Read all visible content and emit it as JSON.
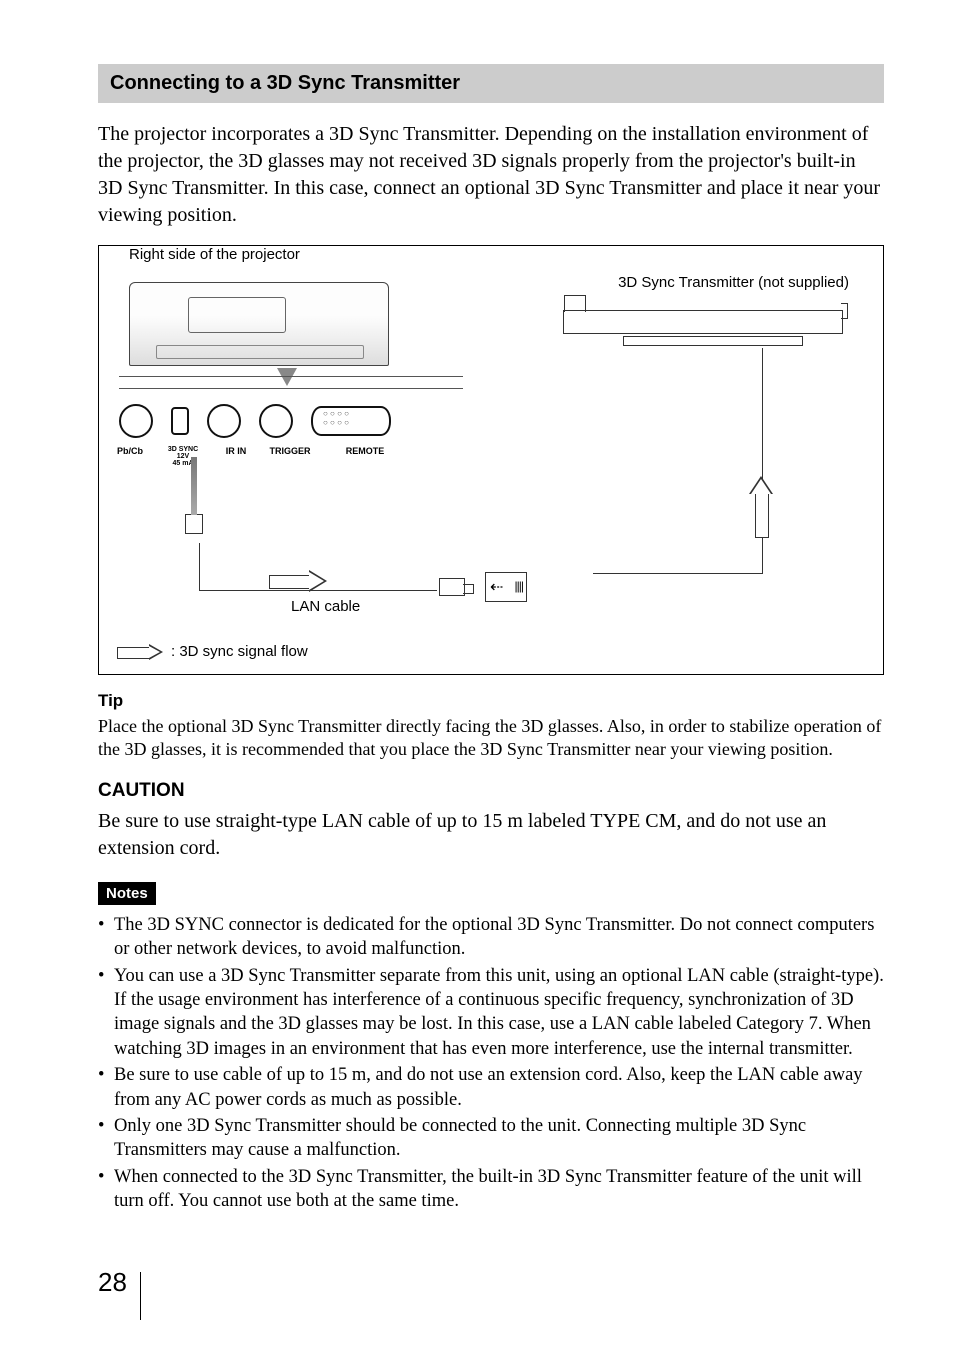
{
  "section_title": "Connecting to a 3D Sync Transmitter",
  "intro": "The projector incorporates a 3D Sync Transmitter. Depending on the installation environment of the projector, the 3D glasses may not received 3D signals properly from the projector's built-in 3D Sync Transmitter. In this case, connect an optional 3D Sync Transmitter and place it near your viewing position.",
  "diagram": {
    "projector_label": "Right side of the projector",
    "transmitter_label": "3D Sync Transmitter (not supplied)",
    "lan_cable_label": "LAN cable",
    "legend": ": 3D sync signal flow",
    "port_labels": {
      "pb_cb": "Pb/Cb",
      "sync": "3D SYNC\n12V\n45 mA",
      "ir_in": "IR IN",
      "trigger": "TRIGGER",
      "remote": "REMOTE"
    }
  },
  "tip_heading": "Tip",
  "tip_text": "Place the optional 3D Sync Transmitter directly facing the 3D glasses. Also, in order to stabilize operation of the 3D glasses, it is recommended that you place the 3D Sync Transmitter near your viewing position.",
  "caution_heading": "CAUTION",
  "caution_text": "Be sure to use straight-type LAN cable of up to 15 m labeled TYPE CM, and do not use an extension cord.",
  "notes_heading": "Notes",
  "notes": [
    {
      "text": "The 3D SYNC connector is dedicated for the optional 3D Sync Transmitter. Do not connect computers or other network devices, to avoid malfunction."
    },
    {
      "text": "You can use a 3D Sync Transmitter separate from this unit, using an optional LAN cable (straight-type).",
      "sub": "If the usage environment has interference of a continuous specific frequency, synchronization of 3D image signals and the 3D glasses may be lost. In this case, use a LAN cable labeled Category 7. When watching 3D images in an environment that has even more interference, use the internal transmitter."
    },
    {
      "text": "Be sure to use cable of up to 15 m, and do not use an extension cord. Also, keep the LAN cable away from any AC power cords as much as possible."
    },
    {
      "text": "Only one 3D Sync Transmitter should be connected to the unit. Connecting multiple 3D Sync Transmitters may cause a malfunction."
    },
    {
      "text": "When connected to the 3D Sync Transmitter, the built-in 3D Sync Transmitter feature of the unit will turn off. You cannot use both at the same time."
    }
  ],
  "page_number": "28"
}
